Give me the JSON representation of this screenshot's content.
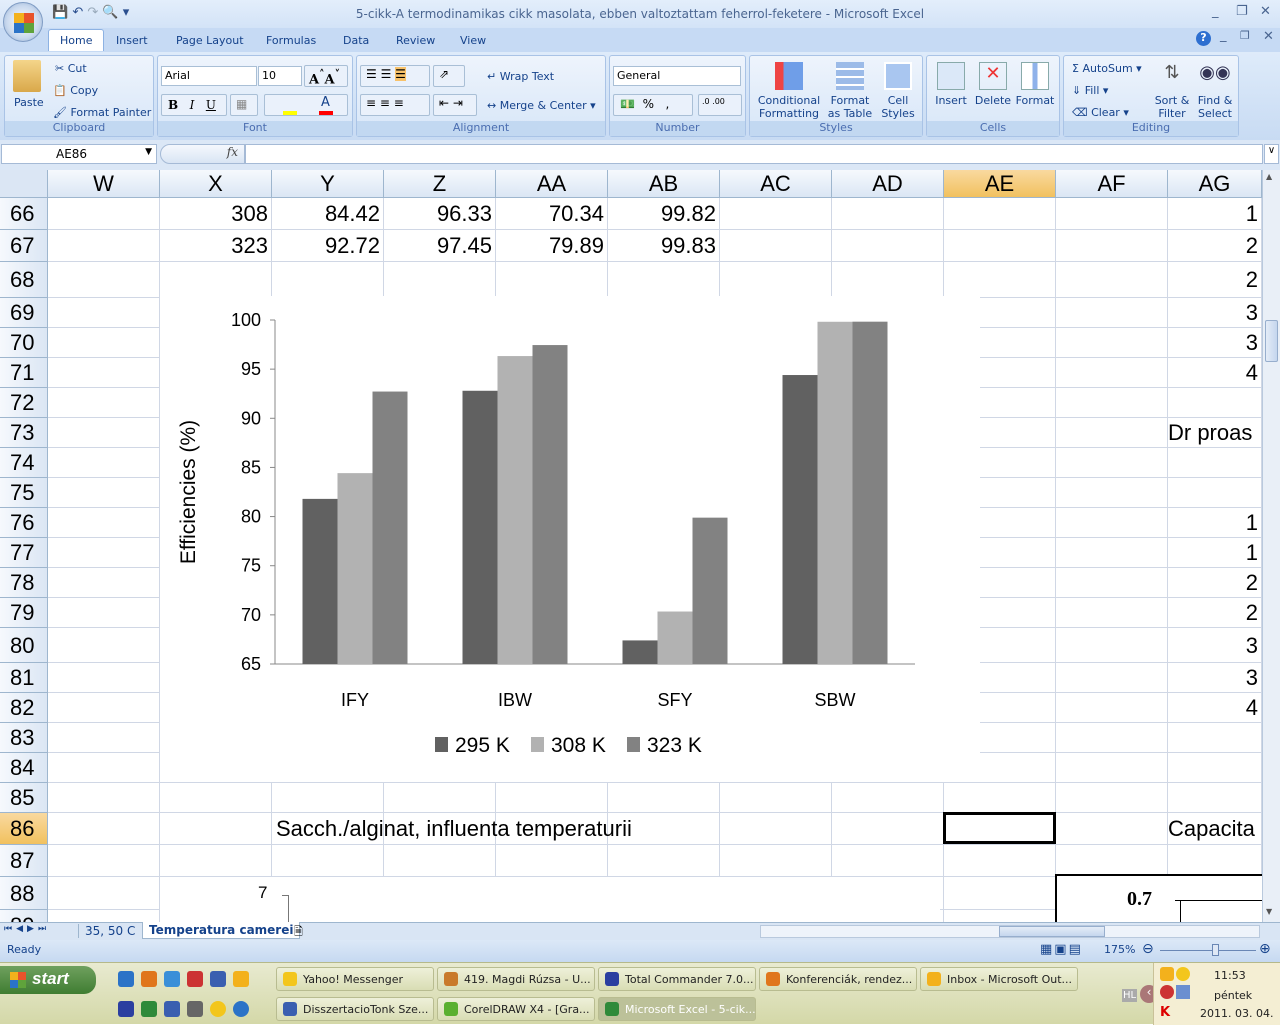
{
  "window": {
    "title": "5-cikk-A termodinamikas cikk masolata, ebben valtoztattam feherrol-feketere - Microsoft Excel"
  },
  "tabs": [
    "Home",
    "Insert",
    "Page Layout",
    "Formulas",
    "Data",
    "Review",
    "View"
  ],
  "ribbon": {
    "clipboard": {
      "label": "Clipboard",
      "paste": "Paste",
      "cut": "Cut",
      "copy": "Copy",
      "format_painter": "Format Painter"
    },
    "font": {
      "label": "Font",
      "name": "Arial",
      "size": "10",
      "bold": "B",
      "italic": "I",
      "underline": "U",
      "fill_color": "#ffff00",
      "font_color": "#ff0000"
    },
    "alignment": {
      "label": "Alignment",
      "wrap_text": "Wrap Text",
      "merge_center": "Merge & Center"
    },
    "number": {
      "label": "Number",
      "format": "General",
      "percent": "%",
      "comma": ","
    },
    "styles": {
      "label": "Styles",
      "conditional": "Conditional",
      "conditional2": "Formatting",
      "format_table": "Format",
      "format_table2": "as Table",
      "cell_styles": "Cell",
      "cell_styles2": "Styles"
    },
    "cells": {
      "label": "Cells",
      "insert": "Insert",
      "delete": "Delete",
      "format": "Format"
    },
    "editing": {
      "label": "Editing",
      "autosum": "AutoSum",
      "fill": "Fill",
      "clear": "Clear",
      "sort": "Sort &",
      "sort2": "Filter",
      "find": "Find &",
      "find2": "Select"
    }
  },
  "formula_bar": {
    "name_box": "AE86",
    "fx": "fx",
    "value": ""
  },
  "columns": [
    "W",
    "X",
    "Y",
    "Z",
    "AA",
    "AB",
    "AC",
    "AD",
    "AE",
    "AF",
    "AG"
  ],
  "selected_column": "AE",
  "rows": [
    "66",
    "67",
    "68",
    "69",
    "70",
    "71",
    "72",
    "73",
    "74",
    "75",
    "76",
    "77",
    "78",
    "79",
    "80",
    "81",
    "82",
    "83",
    "84",
    "85",
    "86",
    "87",
    "88",
    "89"
  ],
  "selected_row": "86",
  "cells": {
    "r66": [
      "308",
      "84.42",
      "96.33",
      "70.34",
      "99.82"
    ],
    "r67": [
      "323",
      "92.72",
      "97.45",
      "79.89",
      "99.83"
    ],
    "ag": {
      "66": "1",
      "67": "2",
      "68": "2",
      "69": "3",
      "70": "3",
      "71": "4",
      "76": "1",
      "77": "1",
      "78": "2",
      "79": "2",
      "80": "3",
      "81": "3",
      "82": "4"
    },
    "ag73": "Dr proas",
    "x86": "Sacch./alginat, influenta temperaturii",
    "ag86": "Capacita"
  },
  "chart_data": {
    "type": "bar",
    "categories": [
      "IFY",
      "IBW",
      "SFY",
      "SBW"
    ],
    "series": [
      {
        "name": "295 K",
        "color": "#616161",
        "values": [
          81.8,
          92.8,
          67.4,
          94.4
        ]
      },
      {
        "name": "308 K",
        "color": "#b2b2b2",
        "values": [
          84.42,
          96.33,
          70.34,
          99.82
        ]
      },
      {
        "name": "323 K",
        "color": "#828282",
        "values": [
          92.72,
          97.45,
          79.89,
          99.83
        ]
      }
    ],
    "ylabel": "Efficiencies (%)",
    "ylim": [
      65,
      100
    ],
    "yticks": [
      "65",
      "70",
      "75",
      "80",
      "85",
      "90",
      "95",
      "100"
    ],
    "legend": "bottom",
    "grid": false
  },
  "chart2": {
    "tick": "7"
  },
  "chart3": {
    "tick": "0.7"
  },
  "sheets": [
    "35, 50 C",
    "Temperatura camerei"
  ],
  "active_sheet": "Temperatura camerei",
  "status": {
    "text": "Ready",
    "zoom": "175%"
  },
  "taskbar": {
    "start": "start",
    "row1": [
      "Yahoo! Messenger",
      "419. Magdi Rúzsa - U...",
      "Total Commander 7.0...",
      "Konferenciák, rendez...",
      "Inbox - Microsoft Out..."
    ],
    "row2": [
      "DisszertacioTonk Sze...",
      "CorelDRAW X4 - [Gra...",
      "Microsoft Excel - 5-cik..."
    ],
    "lang": "HL",
    "time": "11:53",
    "day": "péntek",
    "date": "2011. 03. 04."
  }
}
